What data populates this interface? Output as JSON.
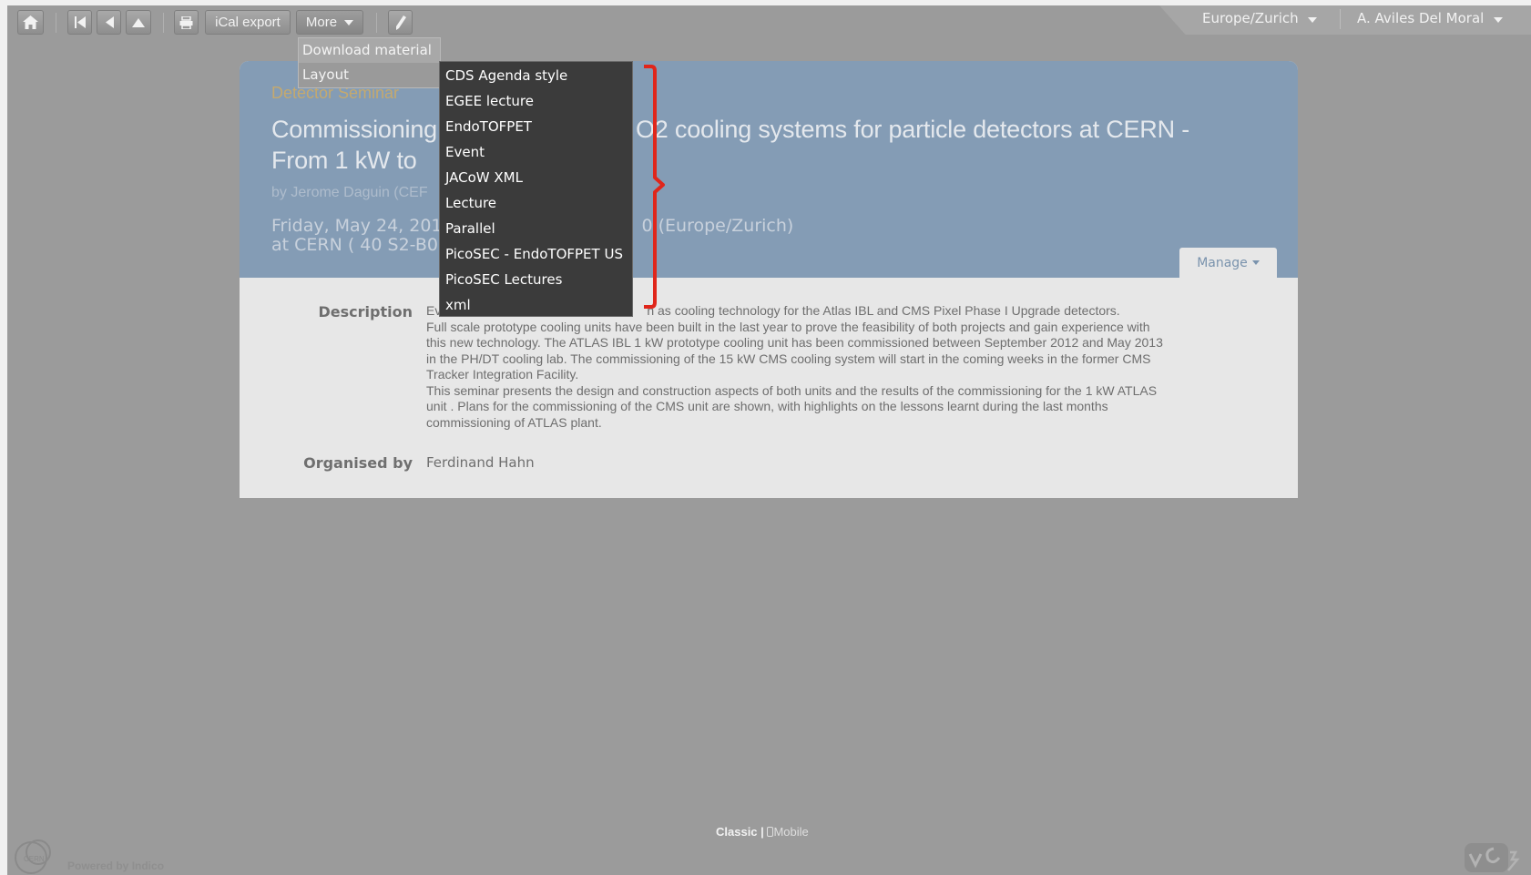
{
  "toolbar": {
    "home_icon": "home-icon",
    "first_icon": "skip-first-icon",
    "prev_icon": "previous-icon",
    "up_icon": "up-icon",
    "print_icon": "print-icon",
    "ical_label": "iCal export",
    "more_label": "More",
    "edit_icon": "pencil-icon"
  },
  "top_right": {
    "timezone": "Europe/Zurich",
    "user": "A. Aviles Del Moral"
  },
  "more_menu": {
    "items": [
      {
        "label": "Download material"
      },
      {
        "label": "Layout"
      }
    ]
  },
  "layout_menu": {
    "items": [
      {
        "label": "CDS Agenda style"
      },
      {
        "label": "EGEE lecture"
      },
      {
        "label": "EndoTOFPET"
      },
      {
        "label": "Event"
      },
      {
        "label": "JACoW XML"
      },
      {
        "label": "Lecture"
      },
      {
        "label": "Parallel"
      },
      {
        "label": "PicoSEC - EndoTOFPET US"
      },
      {
        "label": "PicoSEC Lectures"
      },
      {
        "label": "xml"
      }
    ]
  },
  "event": {
    "category": "Detector Seminar",
    "title_line1": "Commissioning",
    "title_line1_right": "O2 cooling systems for particle detectors at CERN -",
    "title_line2": "From 1 kW to",
    "speaker": "by Jerome Daguin (CEF",
    "date": "Friday, May 24, 201",
    "date_right": "0 (Europe/Zurich)",
    "location": "at CERN ( 40 S2-B0",
    "manage_label": "Manage",
    "description_label": "Description",
    "description_first": "Ev",
    "description_first_right": "n as cooling technology for the Atlas IBL and CMS Pixel Phase I Upgrade detectors.",
    "description_rest": [
      "Full scale prototype cooling units have been built in the last year to prove the feasibility of both projects and gain experience with",
      "this new technology. The ATLAS IBL 1 kW prototype cooling unit has been commissioned between September 2012 and May 2013",
      "in the PH/DT cooling lab. The commissioning of the 15 kW CMS cooling system will start in the coming weeks in the former CMS",
      "Tracker Integration Facility.",
      "This seminar presents the design and construction aspects of both units and the results of the commissioning for the 1 kW ATLAS",
      "unit . Plans for the commissioning of the CMS unit are shown, with highlights on the lessons learnt during the last months",
      "commissioning of ATLAS plant."
    ],
    "organised_label": "Organised by",
    "organiser": "Ferdinand Hahn"
  },
  "footer": {
    "classic": "Classic",
    "separator": "|",
    "mobile": "Mobile",
    "powered": "Powered by Indico",
    "cern_logo_text": "CERN"
  },
  "colors": {
    "overlay": "#9b9b9b",
    "header_band": "#849cb5",
    "submenu_bg": "#3b3b3b",
    "bracket": "#e0261b"
  }
}
